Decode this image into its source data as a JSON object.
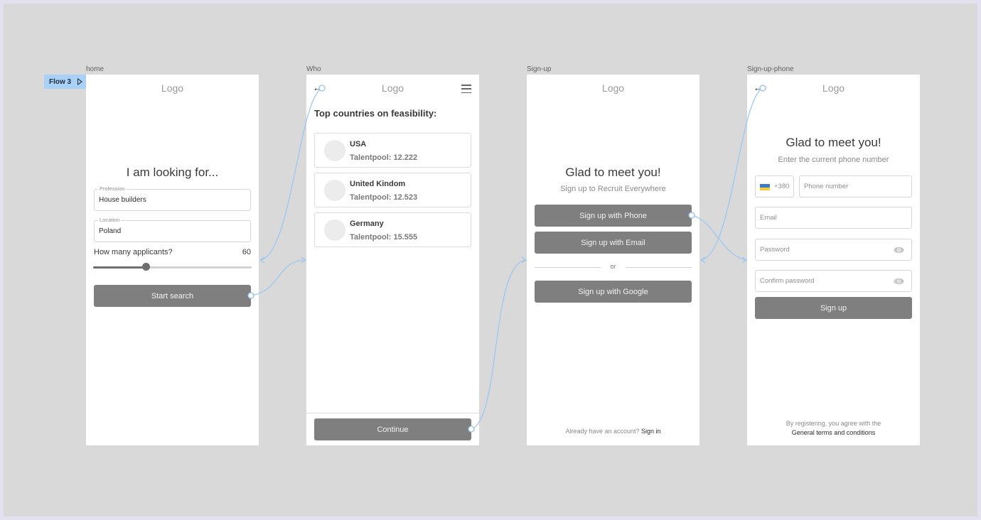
{
  "flow": {
    "label": "Flow 3",
    "icon": "play-icon"
  },
  "screens": {
    "home": {
      "frame_label": "home",
      "logo": "Logo",
      "title": "I am looking for...",
      "profession": {
        "label": "Profession",
        "value": "House builders"
      },
      "location": {
        "label": "Location",
        "value": "Poland"
      },
      "applicants": {
        "label": "How many applicants?",
        "value": "60",
        "slider_fraction": 0.33
      },
      "start_button": "Start search"
    },
    "who": {
      "frame_label": "Who",
      "logo": "Logo",
      "back_icon": "arrow-left-icon",
      "menu_icon": "hamburger-menu-icon",
      "title": "Top countries on feasibility:",
      "countries": [
        {
          "name": "USA",
          "talentpool": "Talentpool: 12.222"
        },
        {
          "name": "United Kindom",
          "talentpool": "Talentpool: 12.523"
        },
        {
          "name": "Germany",
          "talentpool": "Talentpool: 15.555"
        }
      ],
      "continue_button": "Continue"
    },
    "signup": {
      "frame_label": "Sign-up",
      "logo": "Logo",
      "title": "Glad to meet you!",
      "subtitle": "Sign up to Recruit Everywhere",
      "phone_button": "Sign up with Phone",
      "email_button": "Sign up with Email",
      "or_label": "or",
      "google_button": "Sign up with Google",
      "footer_text": "Already have an account?",
      "footer_link": "Sign in"
    },
    "signup_phone": {
      "frame_label": "Sign-up-phone",
      "logo": "Logo",
      "back_icon": "arrow-left-icon",
      "title": "Glad to meet you!",
      "subtitle": "Enter the current phone number",
      "country_code": "+380",
      "flag": "ukraine-flag-icon",
      "phone_placeholder": "Phone number",
      "email_placeholder": "Email",
      "password_placeholder": "Password",
      "confirm_password_placeholder": "Confirm password",
      "signup_button": "Sign up",
      "terms_text": "By registering, you agree with the",
      "terms_link": "General terms and conditions"
    }
  },
  "colors": {
    "connector": "#9cc8f0",
    "button": "#7f7f7f",
    "flow_badge": "#a9d1f7",
    "canvas": "#d9d9d9"
  }
}
